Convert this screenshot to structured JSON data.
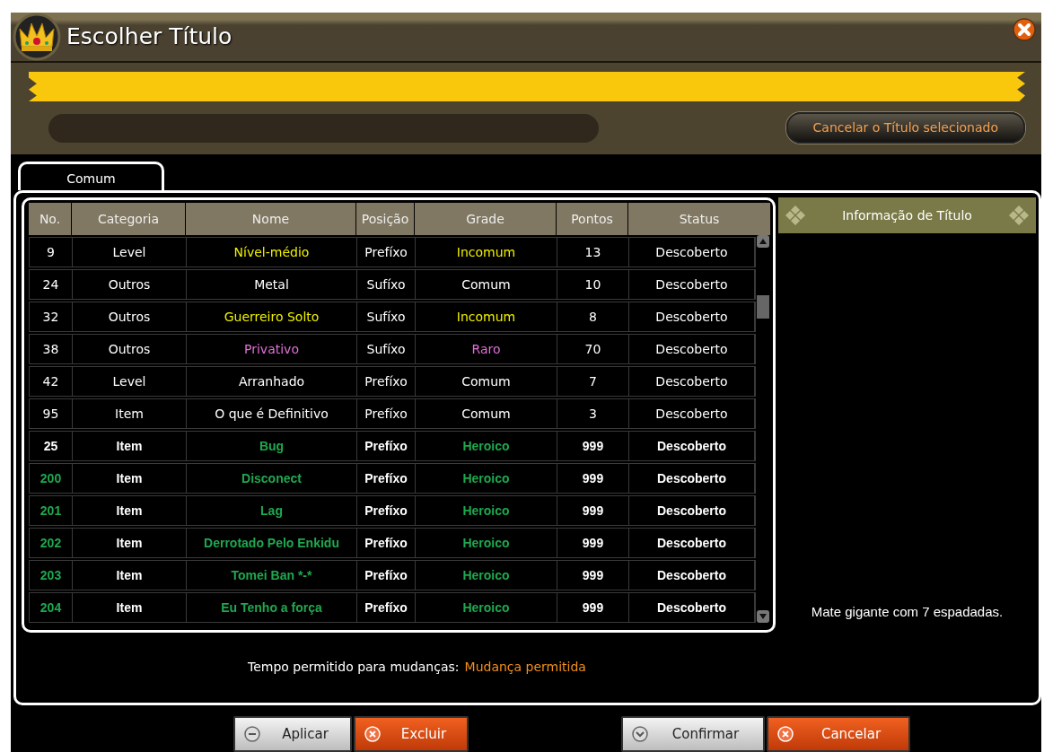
{
  "window": {
    "title": "Escolher Título"
  },
  "current_title": {
    "cancel_button": "Cancelar o Título selecionado"
  },
  "tabs": [
    {
      "label": "Comum",
      "selected": true
    }
  ],
  "table": {
    "columns": [
      "No.",
      "Categoria",
      "Nome",
      "Posição",
      "Grade",
      "Pontos",
      "Status"
    ],
    "rows": [
      {
        "kind": "standard",
        "number_highlighted": false,
        "color": "#f0f000",
        "cells": [
          "9",
          "Level",
          "Nível-médio",
          "Prefíxo",
          "Incomum",
          "13",
          "Descoberto"
        ]
      },
      {
        "kind": "standard",
        "number_highlighted": false,
        "color": "#ffffff",
        "cells": [
          "24",
          "Outros",
          "Metal",
          "Sufíxo",
          "Comum",
          "10",
          "Descoberto"
        ]
      },
      {
        "kind": "standard",
        "number_highlighted": false,
        "color": "#f0f000",
        "cells": [
          "32",
          "Outros",
          "Guerreiro Solto",
          "Sufíxo",
          "Incomum",
          "8",
          "Descoberto"
        ]
      },
      {
        "kind": "standard",
        "number_highlighted": false,
        "color": "#e070d8",
        "cells": [
          "38",
          "Outros",
          "Privativo",
          "Sufíxo",
          "Raro",
          "70",
          "Descoberto"
        ]
      },
      {
        "kind": "standard",
        "number_highlighted": false,
        "color": "#ffffff",
        "cells": [
          "42",
          "Level",
          "Arranhado",
          "Prefíxo",
          "Comum",
          "7",
          "Descoberto"
        ]
      },
      {
        "kind": "standard",
        "number_highlighted": false,
        "color": "#ffffff",
        "cells": [
          "95",
          "Item",
          "O que é Definitivo",
          "Prefíxo",
          "Comum",
          "3",
          "Descoberto"
        ]
      },
      {
        "kind": "special",
        "number_highlighted": false,
        "color": "#1fa84f",
        "cells": [
          "25",
          "Item",
          "Bug",
          "Prefíxo",
          "Heroico",
          "999",
          "Descoberto"
        ]
      },
      {
        "kind": "special",
        "number_highlighted": true,
        "color": "#1fa84f",
        "cells": [
          "200",
          "Item",
          "Disconect",
          "Prefíxo",
          "Heroico",
          "999",
          "Descoberto"
        ]
      },
      {
        "kind": "special",
        "number_highlighted": true,
        "color": "#1fa84f",
        "cells": [
          "201",
          "Item",
          "Lag",
          "Prefíxo",
          "Heroico",
          "999",
          "Descoberto"
        ]
      },
      {
        "kind": "special",
        "number_highlighted": true,
        "color": "#1fa84f",
        "cells": [
          "202",
          "Item",
          "Derrotado Pelo Enkidu",
          "Prefíxo",
          "Heroico",
          "999",
          "Descoberto"
        ]
      },
      {
        "kind": "special",
        "number_highlighted": true,
        "color": "#1fa84f",
        "cells": [
          "203",
          "Item",
          "Tomei Ban *-*",
          "Prefíxo",
          "Heroico",
          "999",
          "Descoberto"
        ]
      },
      {
        "kind": "special",
        "number_highlighted": true,
        "color": "#1fa84f",
        "cells": [
          "204",
          "Item",
          "Eu Tenho a força",
          "Prefíxo",
          "Heroico",
          "999",
          "Descoberto"
        ]
      }
    ]
  },
  "info_panel": {
    "title": "Informação de Título",
    "description": "Mate gigante com 7 espadadas."
  },
  "change_time": {
    "label": "Tempo permitido para mudanças:",
    "value": "Mudança permitida"
  },
  "buttons": [
    {
      "kind": "apply",
      "label": "Aplicar"
    },
    {
      "kind": "delete",
      "label": "Excluir"
    },
    {
      "kind": "confirm",
      "label": "Confirmar"
    },
    {
      "kind": "cancel",
      "label": "Cancelar"
    }
  ]
}
